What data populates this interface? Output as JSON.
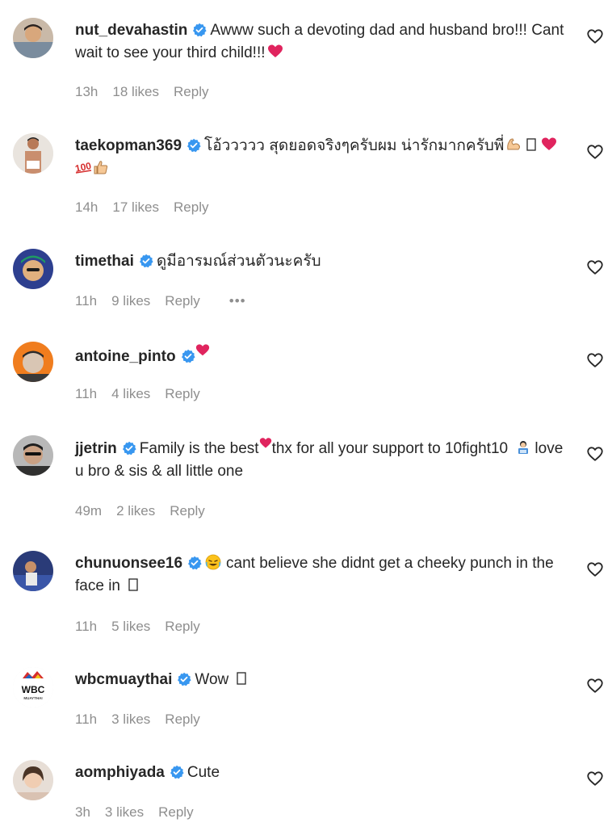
{
  "comments": [
    {
      "username": "nut_devahastin",
      "verified": true,
      "text": "Awww such a devoting dad and husband bro!!! Cant wait to see your third child!!!",
      "emojis": [
        "red-heart"
      ],
      "time": "13h",
      "likes": "18 likes",
      "reply": "Reply"
    },
    {
      "username": "taekopman369",
      "verified": true,
      "text": "โอ้ววววว สุดยอดจริงๆครับผม น่ารักมากครับพี่",
      "emojis": [
        "flexed-biceps",
        "tofu-box",
        "red-heart",
        "hundred-points",
        "thumbs-up"
      ],
      "time": "14h",
      "likes": "17 likes",
      "reply": "Reply"
    },
    {
      "username": "timethai",
      "verified": true,
      "text": "ดูมีอารมณ์ส่วนตัวนะครับ",
      "emojis": [],
      "time": "11h",
      "likes": "9 likes",
      "reply": "Reply",
      "more": "•••"
    },
    {
      "username": "antoine_pinto",
      "verified": true,
      "text": "",
      "emojis": [
        "red-heart"
      ],
      "time": "11h",
      "likes": "4 likes",
      "reply": "Reply"
    },
    {
      "username": "jjetrin",
      "verified": true,
      "text_before": "Family is the best",
      "text_after": "thx for all your support to 10fight10",
      "text_end": "love u bro & sis & all little one",
      "emojis": [
        "red-heart",
        "person-at-computer"
      ],
      "time": "49m",
      "likes": "2 likes",
      "reply": "Reply"
    },
    {
      "username": "chunuonsee16",
      "verified": true,
      "text": "cant believe she didnt get a cheeky punch in the face in",
      "emojis": [
        "crying-laughing-face",
        "tofu-box"
      ],
      "time": "11h",
      "likes": "5 likes",
      "reply": "Reply"
    },
    {
      "username": "wbcmuaythai",
      "verified": true,
      "text": "Wow",
      "emojis": [
        "tofu-box"
      ],
      "avatar_text": "WBC",
      "avatar_subtext": "MUAYTHAI",
      "time": "11h",
      "likes": "3 likes",
      "reply": "Reply"
    },
    {
      "username": "aomphiyada",
      "verified": true,
      "text": "Cute",
      "emojis": [],
      "time": "3h",
      "likes": "3 likes",
      "reply": "Reply"
    }
  ],
  "colors": {
    "text": "#262626",
    "meta": "#8e8e8e",
    "verified": "#3897f0",
    "heart_emoji": "#e0245e"
  },
  "icons": {
    "verified": "verified-badge-icon",
    "like": "heart-outline-icon",
    "more": "more-dots-icon"
  }
}
